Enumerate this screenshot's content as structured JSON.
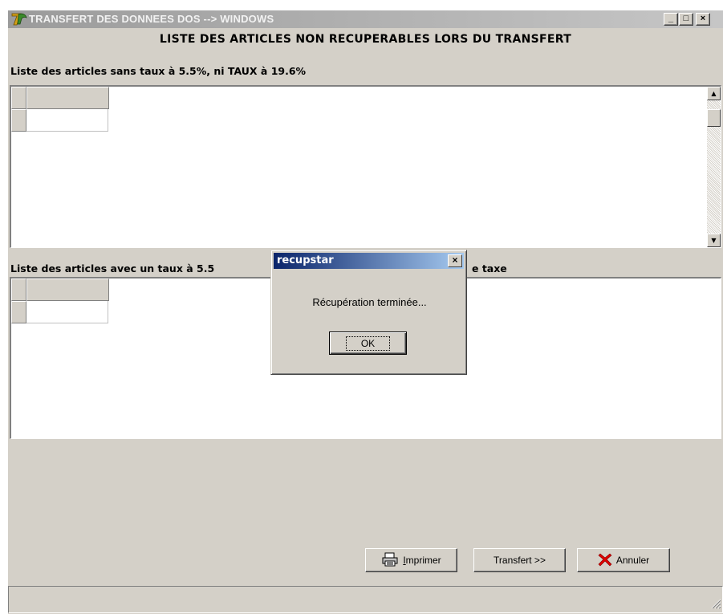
{
  "window": {
    "title": "TRANSFERT DES DONNEES DOS --> WINDOWS",
    "minimize_glyph": "_",
    "maximize_glyph": "□",
    "close_glyph": "×"
  },
  "heading": "LISTE DES ARTICLES NON RECUPERABLES LORS DU TRANSFERT",
  "section1": {
    "label": "Liste des articles sans taux à 5.5%, ni TAUX à 19.6%"
  },
  "section2": {
    "label": "Liste des articles avec un taux à 5.5",
    "label_tail": "e taxe"
  },
  "buttons": {
    "print_prefix": "I",
    "print_rest": "mprimer",
    "transfer": "Transfert >>",
    "cancel": "Annuler"
  },
  "dialog": {
    "title": "recupstar",
    "close_glyph": "×",
    "message": "Récupération terminée...",
    "ok": "OK"
  },
  "colors": {
    "dialog_title_start": "#0a246a",
    "dialog_title_end": "#a6caf0",
    "cancel_icon": "#e00000"
  },
  "icons": {
    "app": "app-logo-icon",
    "print": "printer-icon",
    "cancel": "red-x-icon",
    "scroll_up": "arrow-up-icon",
    "scroll_down": "arrow-down-icon",
    "grip": "resize-grip-icon"
  }
}
